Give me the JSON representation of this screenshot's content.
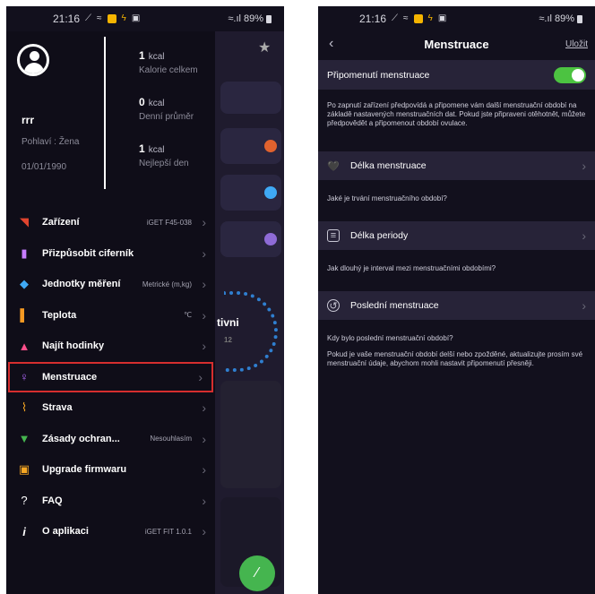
{
  "left_screen": {
    "status": {
      "time": "21:16",
      "signal": "≈.ıl",
      "battery": "89%"
    },
    "profile": {
      "username": "rrr",
      "gender": "Pohlaví : Žena",
      "birthdate": "01/01/1990",
      "stats": [
        {
          "value": "1",
          "unit": "kcal",
          "label": "Kalorie celkem"
        },
        {
          "value": "0",
          "unit": "kcal",
          "label": "Denní průměr"
        },
        {
          "value": "1",
          "unit": "kcal",
          "label": "Nejlepší den"
        }
      ]
    },
    "menu": [
      {
        "label": "Zařízení",
        "value": "iGET F45-038",
        "icon": "signal-icon",
        "color": "#e0442e"
      },
      {
        "label": "Přizpůsobit ciferník",
        "value": "",
        "icon": "watch-face-icon",
        "color": "#c77dff"
      },
      {
        "label": "Jednotky měření",
        "value": "Metrické (m,kg)",
        "icon": "ruler-icon",
        "color": "#3fa9f5"
      },
      {
        "label": "Teplota",
        "value": "℃",
        "icon": "thermometer-icon",
        "color": "#f59a23"
      },
      {
        "label": "Najít hodinky",
        "value": "",
        "icon": "bell-icon",
        "color": "#ff4f8b"
      },
      {
        "label": "Menstruace",
        "value": "",
        "icon": "female-icon",
        "color": "#b36bff"
      },
      {
        "label": "Strava",
        "value": "",
        "icon": "activity-icon",
        "color": "#f5a623"
      },
      {
        "label": "Zásady ochran...",
        "value": "Nesouhlasím",
        "icon": "shield-icon",
        "color": "#45b54f"
      },
      {
        "label": "Upgrade firmwaru",
        "value": "",
        "icon": "firmware-icon",
        "color": "#f5a623"
      },
      {
        "label": "FAQ",
        "value": "",
        "icon": "question-icon",
        "color": "#ffffff"
      },
      {
        "label": "O aplikaci",
        "value": "iGET FIT 1.0.1",
        "icon": "info-icon",
        "color": "#ffffff"
      }
    ],
    "background": {
      "partial_text": "tivni",
      "partial_num": "12"
    }
  },
  "right_screen": {
    "status": {
      "time": "21:16",
      "signal": "≈.ıl",
      "battery": "89%"
    },
    "title": "Menstruace",
    "save": "Uložit",
    "reminder": {
      "label": "Připomenutí menstruace",
      "enabled": true,
      "description": "Po zapnutí zařízení předpovídá a připomene vám další menstruační období na základě nastavených menstruačních dat. Pokud jste připraveni otěhotnět, můžete předpovědět a připomenout období ovulace."
    },
    "sections": [
      {
        "label": "Délka menstruace",
        "question": "Jaké je trvání menstruačního období?",
        "icon": "body-icon"
      },
      {
        "label": "Délka periody",
        "question": "Jak dlouhý je interval mezi menstruačními obdobími?",
        "icon": "calendar-icon"
      },
      {
        "label": "Poslední menstruace",
        "question": "Kdy bylo poslední menstruační období?",
        "icon": "history-icon"
      }
    ],
    "footer_note": "Pokud je vaše menstruační období delší nebo zpožděné, aktualizujte prosím své menstruační údaje, abychom mohli nastavit připomenutí přesněji."
  },
  "colors": {
    "highlight": "#d62e2e",
    "toggle_on": "#4cc341",
    "panel": "#272338",
    "bg": "#12101d"
  }
}
